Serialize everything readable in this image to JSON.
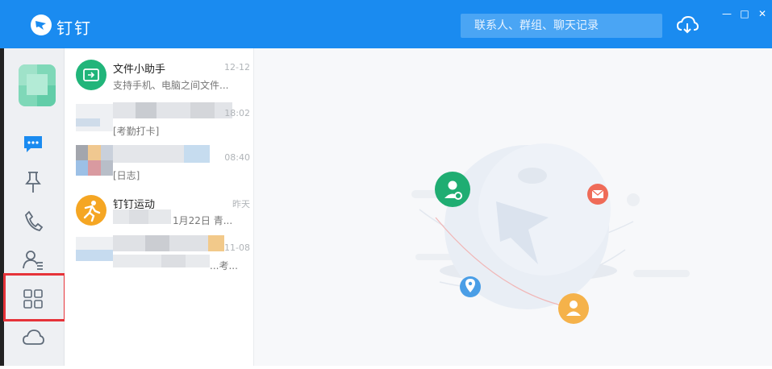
{
  "header": {
    "app_name": "钉钉",
    "search_placeholder": "联系人、群组、聊天记录"
  },
  "window_controls": {
    "minimize": "—",
    "maximize": "□",
    "close": "✕"
  },
  "sidebar": {
    "items": [
      {
        "icon": "chat-bubble-icon"
      },
      {
        "icon": "pin-icon"
      },
      {
        "icon": "phone-icon"
      },
      {
        "icon": "contacts-icon"
      },
      {
        "icon": "workbench-grid-icon"
      },
      {
        "icon": "cloud-icon"
      }
    ]
  },
  "conversations": [
    {
      "title": "文件小助手",
      "subtitle": "支持手机、电脑之间文件...",
      "time": "12-12"
    },
    {
      "title": "…",
      "subtitle": "[考勤打卡]",
      "time": "18:02"
    },
    {
      "title": "",
      "subtitle": "[日志]",
      "time": "08:40"
    },
    {
      "title": "钉钉运动",
      "subtitle": "1月22日 青...",
      "time": "昨天"
    },
    {
      "title": "",
      "subtitle": "...考...",
      "time": "11-08"
    }
  ],
  "colors": {
    "titlebar": "#1a8bf0",
    "accent": "#1a8bf0",
    "highlight": "#e63339"
  }
}
